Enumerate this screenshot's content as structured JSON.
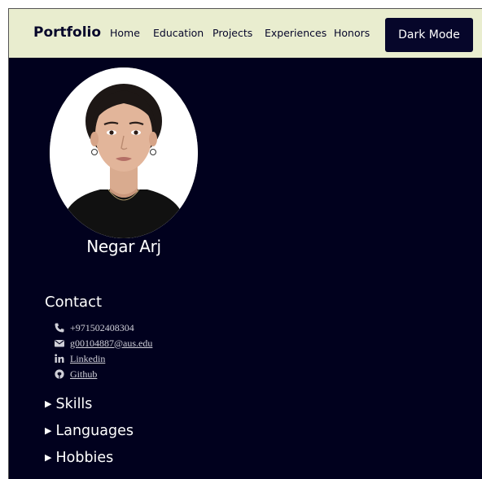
{
  "navbar": {
    "brand": "Portfolio",
    "links": [
      "Home",
      "Education",
      "Projects",
      "Experiences",
      "Honors"
    ],
    "mode_button_label": "Dark Mode"
  },
  "profile": {
    "name": "Negar Arj"
  },
  "contact": {
    "heading": "Contact",
    "phone": "+971502408304",
    "email": "g00104887@aus.edu",
    "linkedin_label": "Linkedin",
    "github_label": "Github"
  },
  "sections": [
    "Skills",
    "Languages",
    "Hobbies"
  ],
  "icons": {
    "phone": "phone-icon",
    "email": "envelope-icon",
    "linkedin": "linkedin-icon",
    "github": "github-icon",
    "disclosure": "triangle-right-icon"
  },
  "colors": {
    "page_background": "#01011e",
    "navbar_background": "#e9edcf",
    "navbar_text": "#06062a",
    "button_background": "#06062a",
    "text": "#ffffff"
  }
}
